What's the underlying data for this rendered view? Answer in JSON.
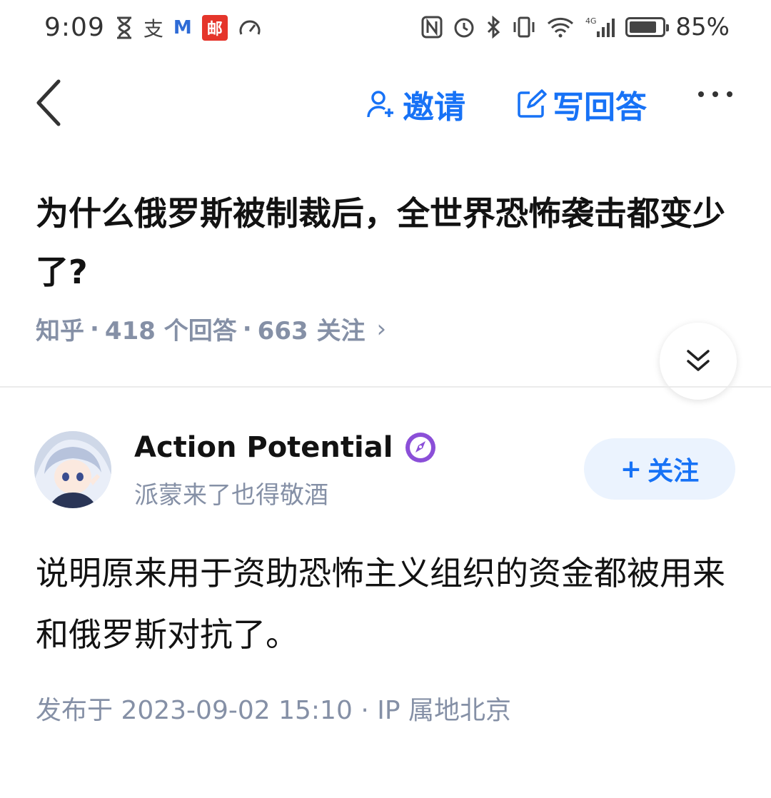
{
  "status_bar": {
    "time": "9:09",
    "left_icons": [
      "hourglass-icon",
      "alipay-icon",
      "gmail-icon",
      "mail-app-icon",
      "speedometer-icon"
    ],
    "mail_app_glyph": "邮",
    "alipay_glyph": "支",
    "gmail_glyph": "M",
    "right_icons": [
      "nfc-icon",
      "alarm-icon",
      "bluetooth-icon",
      "vibrate-icon",
      "wifi-icon",
      "signal-4g-icon",
      "battery-icon"
    ],
    "network_label": "4G",
    "battery_level": 0.85,
    "battery_text": "85%"
  },
  "nav": {
    "invite_label": "邀请",
    "write_answer_label": "写回答",
    "accent_color": "#1772f6"
  },
  "question": {
    "title": "为什么俄罗斯被制裁后，全世界恐怖袭击都变少了?",
    "source": "知乎",
    "answers_count": "418 个回答",
    "followers_count": "663 关注",
    "separator": "·",
    "chevron": "›"
  },
  "answer": {
    "author_name": "Action Potential",
    "author_bio": "派蒙来了也得敬酒",
    "follow_label": "关注",
    "follow_plus": "+",
    "content": "说明原来用于资助恐怖主义组织的资金都被用来和俄罗斯对抗了。",
    "published": "发布于 2023-09-02 15:10",
    "ip_location": "IP 属地北京",
    "meta_separator": "·"
  }
}
